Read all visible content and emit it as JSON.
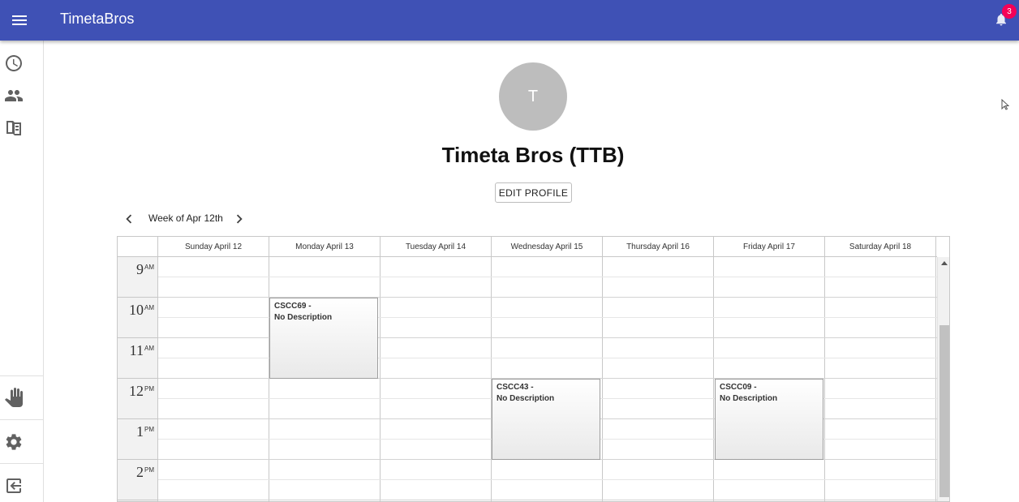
{
  "app": {
    "title": "TimetaBros"
  },
  "appbar": {
    "notification_count": "3"
  },
  "icons": {
    "menu": "menu-icon",
    "bell": "bell-icon",
    "clock": "clock-icon",
    "people": "people-icon",
    "book": "book-icon",
    "hand": "hand-icon",
    "gear": "gear-icon",
    "logout": "logout-icon"
  },
  "profile": {
    "avatar_letter": "T",
    "name": "Timeta Bros (TTB)",
    "edit_label": "EDIT PROFILE"
  },
  "calendar": {
    "week_label": "Week of Apr 12th",
    "days": [
      "Sunday April 12",
      "Monday April 13",
      "Tuesday April 14",
      "Wednesday April 15",
      "Thursday April 16",
      "Friday April 17",
      "Saturday April 18"
    ],
    "hours": [
      {
        "num": "9",
        "ampm": "AM"
      },
      {
        "num": "10",
        "ampm": "AM"
      },
      {
        "num": "11",
        "ampm": "AM"
      },
      {
        "num": "12",
        "ampm": "PM"
      },
      {
        "num": "1",
        "ampm": "PM"
      },
      {
        "num": "2",
        "ampm": "PM"
      }
    ],
    "events": [
      {
        "title": "CSCC69 -",
        "description": "No Description",
        "day": "Monday April 13",
        "start": "10 AM",
        "end": "12 PM"
      },
      {
        "title": "CSCC43 -",
        "description": "No Description",
        "day": "Wednesday April 15",
        "start": "12 PM",
        "end": "2 PM"
      },
      {
        "title": "CSCC09 -",
        "description": "No Description",
        "day": "Friday April 17",
        "start": "12 PM",
        "end": "2 PM"
      }
    ]
  },
  "colors": {
    "appbar": "#3f51b5",
    "badge": "#f50057",
    "avatar": "#bdbdbd"
  }
}
